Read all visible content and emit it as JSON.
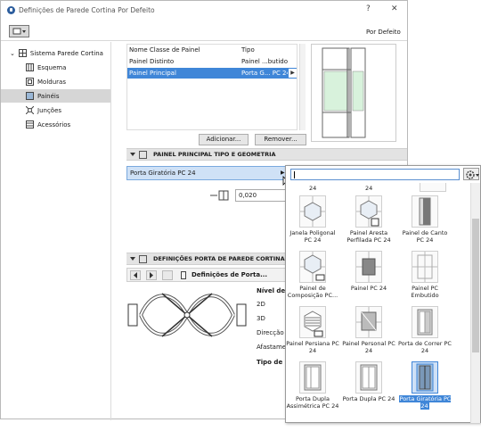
{
  "window": {
    "title": "Definições de Parede Cortina Por Defeito",
    "help_glyph": "?",
    "close_glyph": "✕",
    "preset_label": "Por Defeito"
  },
  "tree": {
    "root": "Sistema Parede Cortina",
    "items": [
      {
        "label": "Esquema"
      },
      {
        "label": "Molduras"
      },
      {
        "label": "Painéis"
      },
      {
        "label": "Junções"
      },
      {
        "label": "Acessórios"
      }
    ]
  },
  "panel_table": {
    "headers": [
      "Nome Classe de Painel",
      "Tipo"
    ],
    "rows": [
      {
        "name": "Painel Distinto",
        "type": "Painel ...butido"
      },
      {
        "name": "Painel Principal",
        "type": "Porta G... PC 24"
      }
    ],
    "selected_row_index": 1
  },
  "buttons": {
    "add": "Adicionar...",
    "remove": "Remover..."
  },
  "section_type": {
    "title": "PAINEL PRINCIPAL TIPO E GEOMETRIA"
  },
  "selector": {
    "value": "Porta Giratória PC 24"
  },
  "thickness": {
    "value": "0,020"
  },
  "section_door": {
    "title": "DEFINIÇÕES PORTA DE PAREDE CORTINA"
  },
  "door_nav": {
    "label": "Definições de Porta..."
  },
  "door_props": {
    "labels": [
      "Nível de D",
      "2D",
      "3D",
      "Direcção T",
      "Afastamen",
      "Tipo de l'o"
    ]
  },
  "popup": {
    "search_value": "",
    "top_row_labels": [
      "24",
      "24"
    ],
    "items": [
      {
        "label": "Janela Poligonal PC 24",
        "icon": "hexagon-window-icon"
      },
      {
        "label": "Painel Aresta Perfilada PC 24",
        "icon": "hexagon-profile-icon"
      },
      {
        "label": "Painel de Canto PC 24",
        "icon": "corner-panel-icon"
      },
      {
        "label": "Painel de Composição PC...",
        "icon": "composition-panel-icon"
      },
      {
        "label": "Painel PC 24",
        "icon": "panel-icon"
      },
      {
        "label": "Painel PC Embutido",
        "icon": "embedded-panel-icon"
      },
      {
        "label": "Painel Persiana PC 24",
        "icon": "blind-panel-icon"
      },
      {
        "label": "Painel Personal PC 24",
        "icon": "custom-panel-icon"
      },
      {
        "label": "Porta de Correr PC 24",
        "icon": "sliding-door-icon"
      },
      {
        "label": "Porta Dupla Assimétrica PC 24",
        "icon": "asym-double-door-icon"
      },
      {
        "label": "Porta Dupla PC 24",
        "icon": "double-door-icon"
      },
      {
        "label": "Porta Giratória PC 24",
        "icon": "revolving-door-icon"
      }
    ],
    "selected_index": 11
  },
  "colors": {
    "selection_blue": "#3f86d8",
    "selection_light": "#cfe1f6",
    "section_gray": "#e3e3e3",
    "preview_glass": "#d8f2dc"
  }
}
